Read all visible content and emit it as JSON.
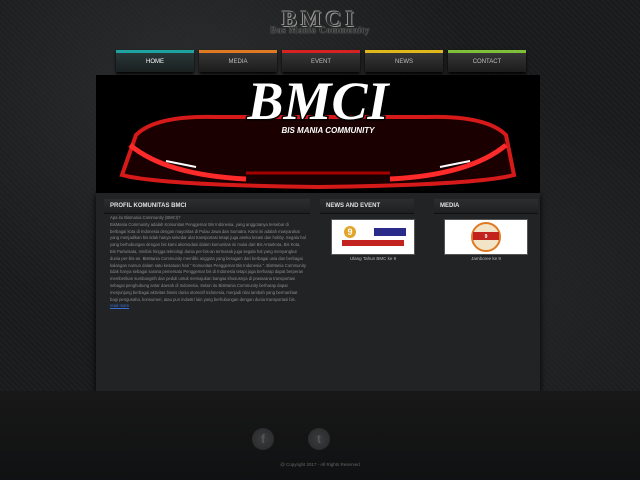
{
  "header": {
    "title": "BMCI",
    "subtitle": "Bus Mania Community"
  },
  "nav": {
    "items": [
      {
        "label": "HOME",
        "color": "#1fa3a0",
        "active": true
      },
      {
        "label": "MEDIA",
        "color": "#e07a22"
      },
      {
        "label": "EVENT",
        "color": "#d62222"
      },
      {
        "label": "NEWS",
        "color": "#e0b81c"
      },
      {
        "label": "CONTACT",
        "color": "#7fbf3a"
      }
    ]
  },
  "banner": {
    "logo_text": "BMCI",
    "logo_sub": "BIS MANIA COMMUNITY"
  },
  "profile": {
    "heading": "PROFIL KOMUNITAS BMCI",
    "intro": "Apa itu Bismania Community (BMCI)?",
    "body": "BisMania Community adalah Komunitas Penggemar Bis Indonesia, yang anggotanya tersebar di berbagai kota di Indonesia dengan mayoritas di Pulau Jawa dan Sumatra. Kami ini adalah masyarakat yang menjadikan bis tidak hanya sekedar alat transportasi tetapi juga aneka kreasi dan hobby. Segala hal yang berhubungan dengan bis kami akomodasi dalam komunitas ini mulai dari Bis Antarkota, Bis Kota, Bis Pariwisata, minibis hingga teknologi dunia per-bis-an termasuk juga segala hal yang menyangkut dunia per-bis-an. BisMania Community memiliki anggota yang beragam dari berbagai usia dan berbagai kalangan namun dalam satu kesatuan hati \" Komunitas Penggemar Bis Indonesia \". BisMania Community tidak hanya sebagai sarana pemersatu Penggemar bis di Indonesia tetapi juga berharap dapat berperan memberikan sumbangsih dan peduli untuk memajukan bangsa khususnya di prasarana transportasi sebagai penghubung antar daerah di Indonesia. Selain itu BisMania Community berharap dapat menjunjung berbagai aktivitas bisnis dunia otomotif Indonesia, menjadi nilai tambah yang bermanfaat bagi pengusaha, konsumen, atau pun industri lain yang berhubungan dengan dunia transportasi bis.",
    "more_link": "read more"
  },
  "news": {
    "heading": "NEWS AND EVENT",
    "caption": "Ulang Tahun BMC ke 9"
  },
  "media": {
    "heading": "MEDIA",
    "caption": "Jamboree ke 9"
  },
  "footer": {
    "facebook": "f",
    "twitter": "t",
    "copyright": "@ Copyright 2017 - All Rights Reserved"
  }
}
